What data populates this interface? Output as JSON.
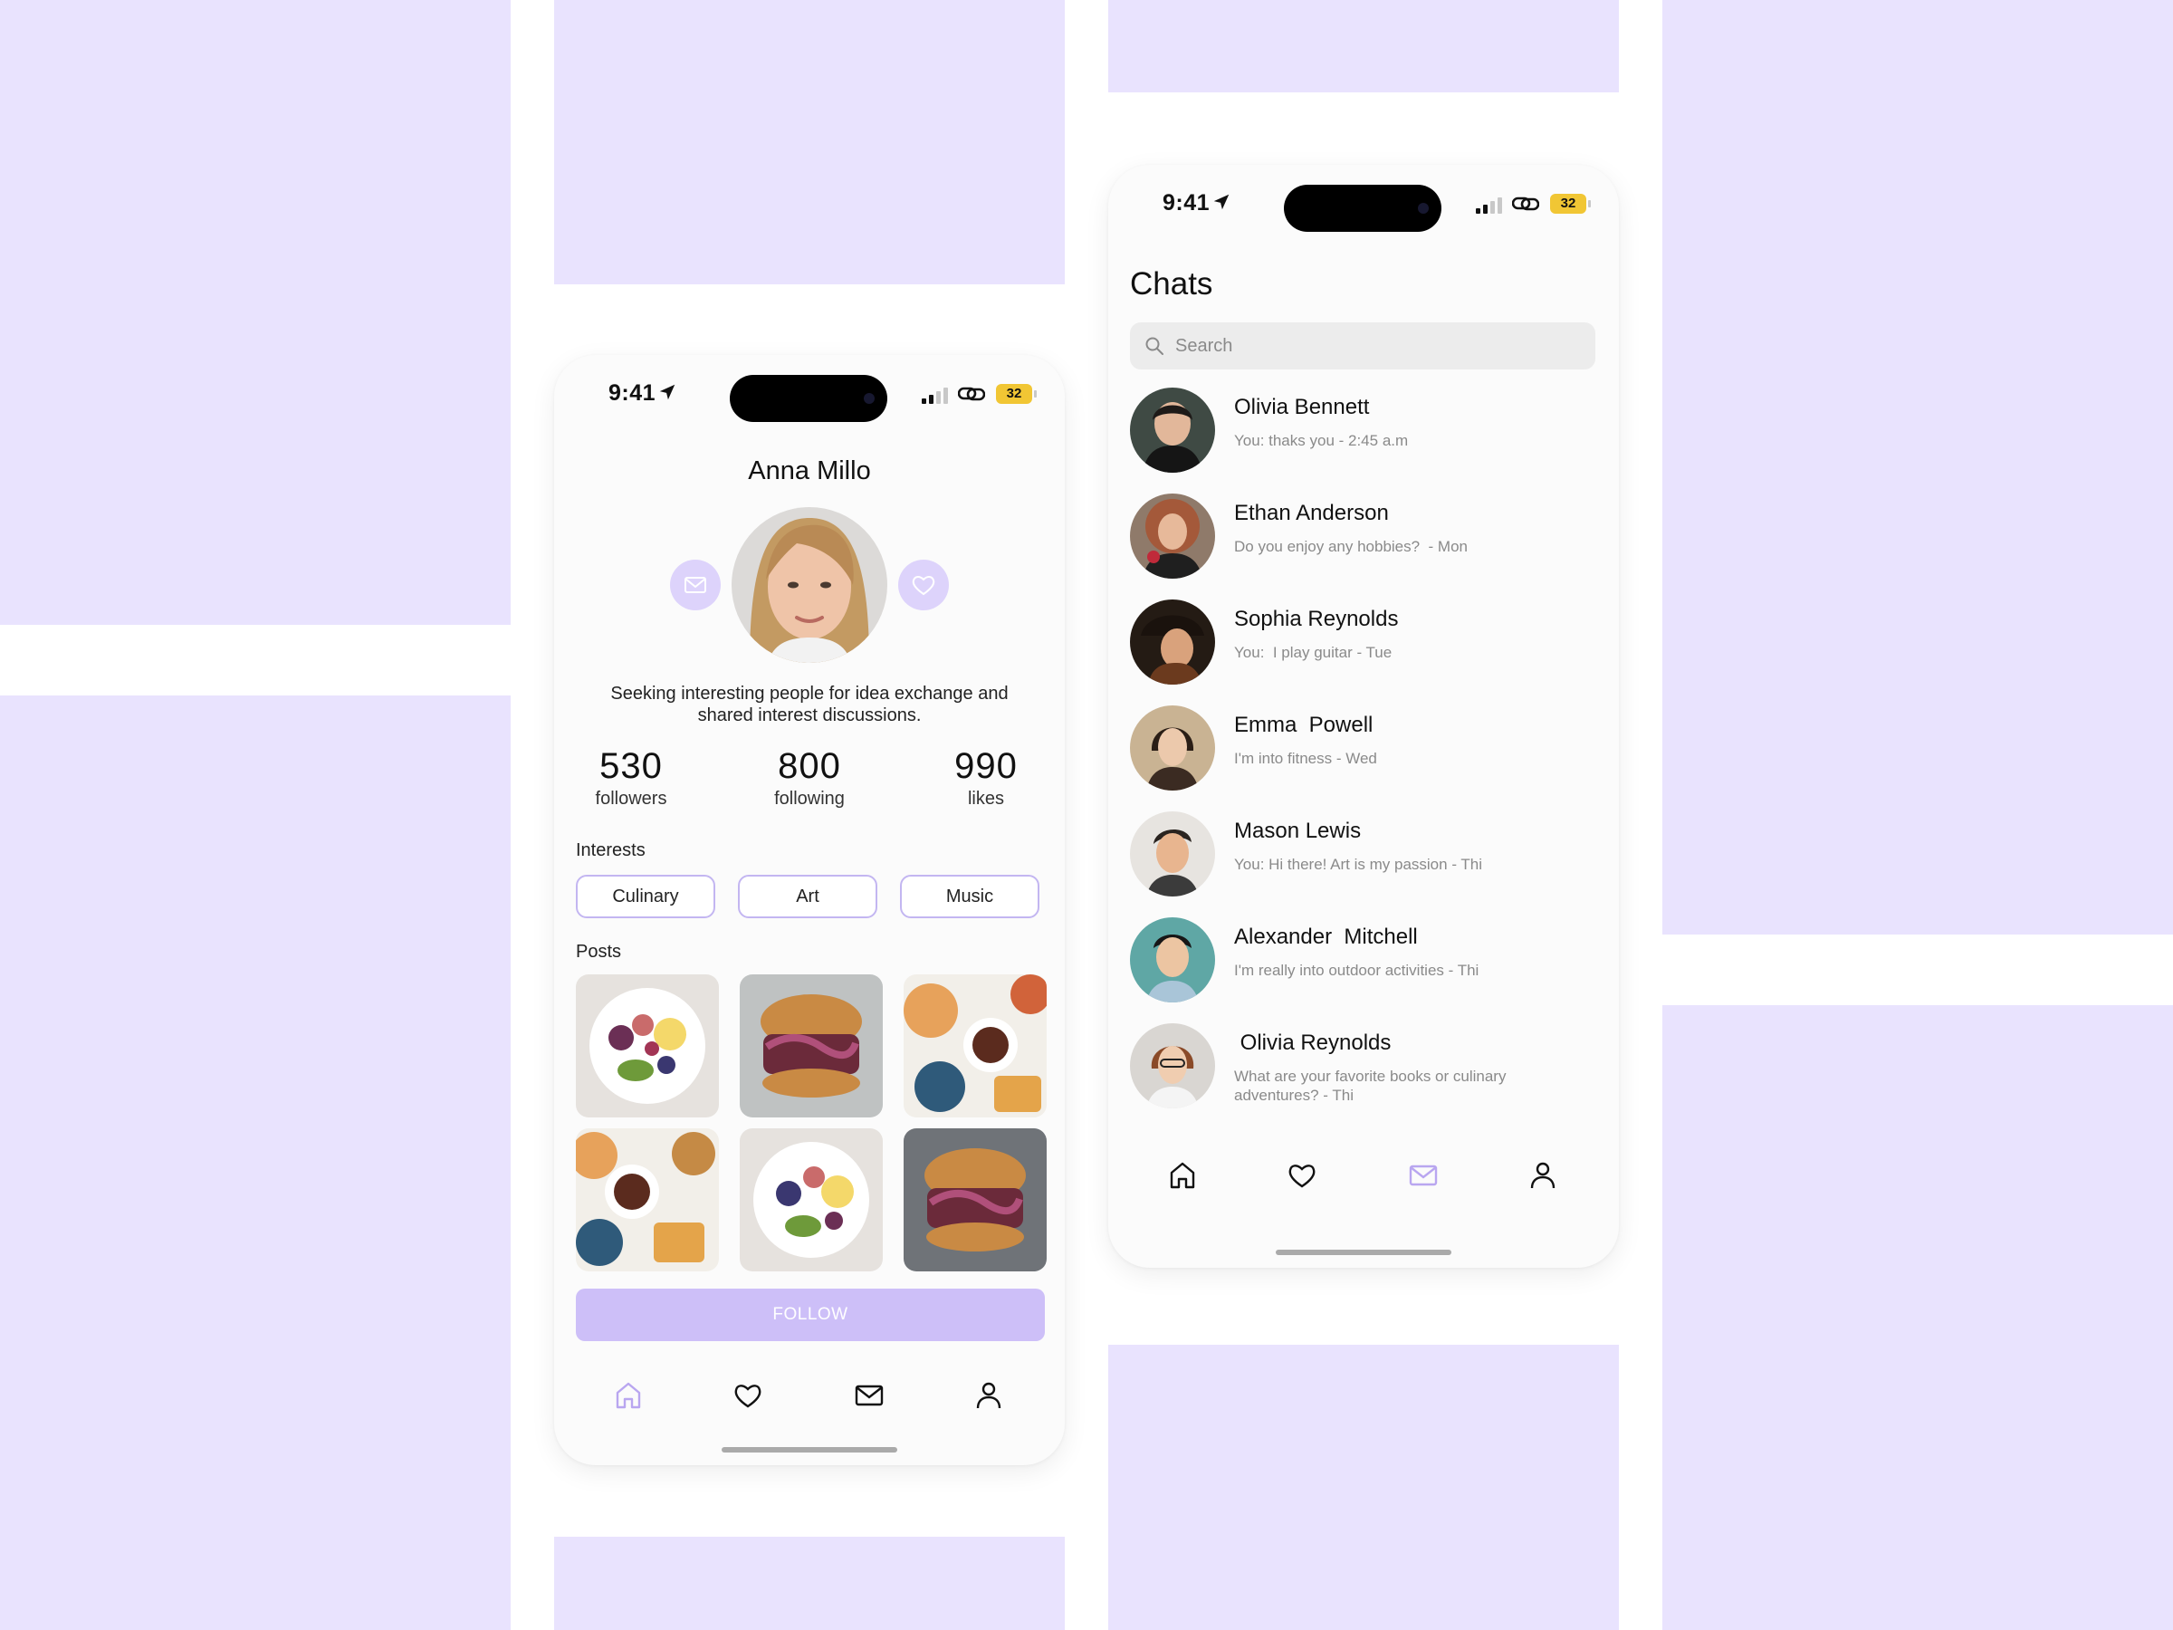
{
  "status_bar": {
    "time": "9:41",
    "battery": "32"
  },
  "profile": {
    "name": "Anna Millo",
    "bio": "Seeking interesting people for idea exchange and shared interest discussions.",
    "stats": [
      {
        "value": "530",
        "label": "followers"
      },
      {
        "value": "800",
        "label": "following"
      },
      {
        "value": "990",
        "label": "likes"
      }
    ],
    "interests_label": "Interests",
    "interests": [
      "Culinary",
      "Art",
      "Music"
    ],
    "posts_label": "Posts",
    "posts": [
      "fruit-bowl",
      "burger",
      "breakfast-spread",
      "breakfast-spread",
      "fruit-bowl",
      "burger"
    ],
    "follow_label": "FOLLOW",
    "tabbar_active": "home"
  },
  "chats": {
    "title": "Chats",
    "search_placeholder": "Search",
    "items": [
      {
        "name": "Olivia Bennett",
        "message": "You: thaks you - 2:45 a.m"
      },
      {
        "name": "Ethan Anderson",
        "message": "Do you enjoy any hobbies?  - Mon"
      },
      {
        "name": "Sophia Reynolds",
        "message": "You:  I play guitar - Tue"
      },
      {
        "name": "Emma  Powell",
        "message": "I'm into fitness - Wed"
      },
      {
        "name": "Mason Lewis",
        "message": "You: Hi there! Art is my passion - Thi"
      },
      {
        "name": "Alexander  Mitchell",
        "message": "I'm really into outdoor activities - Thi"
      },
      {
        "name": " Olivia Reynolds",
        "message": "What are your favorite books or culinary\nadventures? - Thi"
      }
    ],
    "tabbar_active": "messages"
  },
  "colors": {
    "accent": "#cdbff8",
    "accent_light": "#ddd3fb",
    "active_icon": "#b9a6f0",
    "panel_bg": "#e9e3fe",
    "chip_border": "#c3b6f1"
  }
}
